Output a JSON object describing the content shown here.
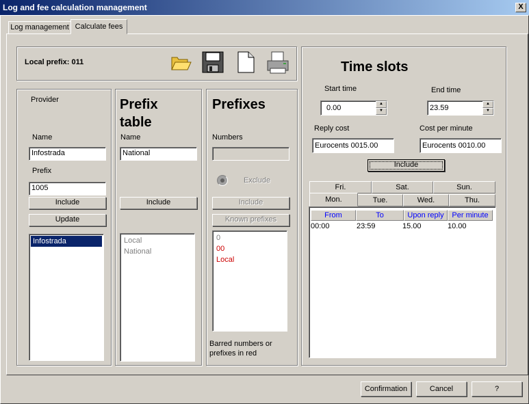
{
  "window": {
    "title": "Log and fee calculation management",
    "close_label": "X"
  },
  "tabs": [
    "Log management",
    "Calculate fees"
  ],
  "header": {
    "local_prefix": "Local prefix: 011"
  },
  "provider": {
    "section_label": "Provider",
    "name_label": "Name",
    "name_value": "Infostrada",
    "prefix_label": "Prefix",
    "prefix_value": "1005",
    "include_label": "Include",
    "update_label": "Update",
    "list": [
      "Infostrada"
    ]
  },
  "prefix_table": {
    "title_line1": "Prefix",
    "title_line2": "table",
    "name_label": "Name",
    "name_value": "National",
    "include_label": "Include",
    "list": [
      "Local",
      "National"
    ]
  },
  "prefixes": {
    "title": "Prefixes",
    "numbers_label": "Numbers",
    "numbers_value": "",
    "exclude_label": "Exclude",
    "include_label": "Include",
    "known_label": "Known prefixes",
    "list": [
      {
        "text": "0",
        "barred": false
      },
      {
        "text": "00",
        "barred": true
      },
      {
        "text": "Local",
        "barred": true
      }
    ],
    "note": "Barred numbers or prefixes in red",
    "barred_color": "#cc0000"
  },
  "time_slots": {
    "title": "Time slots",
    "start_label": "Start time",
    "start_value": "0.00",
    "end_label": "End time",
    "end_value": "23.59",
    "reply_cost_label": "Reply cost",
    "reply_cost_value": "Eurocents 0015.00",
    "cost_per_minute_label": "Cost per minute",
    "cost_per_minute_value": "Eurocents 0010.00",
    "include_label": "Include",
    "day_tabs_row1": [
      "Fri.",
      "Sat.",
      "Sun."
    ],
    "day_tabs_row2": [
      "Mon.",
      "Tue.",
      "Wed.",
      "Thu."
    ],
    "columns": [
      "From",
      "To",
      "Upon reply",
      "Per minute"
    ],
    "rows": [
      [
        "00:00",
        "23:59",
        "15.00",
        "10.00"
      ]
    ]
  },
  "footer": {
    "confirm_label": "Confirmation",
    "cancel_label": "Cancel",
    "help_label": "?"
  },
  "icons": [
    "folder-open-icon",
    "save-disk-icon",
    "new-document-icon",
    "printer-icon"
  ]
}
